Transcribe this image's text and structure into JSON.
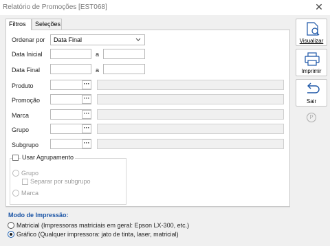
{
  "window": {
    "title": "Relatório de Promoções [EST068]",
    "close_glyph": "✕"
  },
  "tabs": [
    {
      "label": "Filtros",
      "active": true
    },
    {
      "label": "Seleções",
      "active": false
    }
  ],
  "filters": {
    "ordenar_por_label": "Ordenar por",
    "ordenar_por_value": "Data Final",
    "data_inicial_label": "Data Inicial",
    "data_final_label": "Data Final",
    "range_separator": "a",
    "produto_label": "Produto",
    "promocao_label": "Promoção",
    "marca_label": "Marca",
    "grupo_label": "Grupo",
    "subgrupo_label": "Subgrupo",
    "lookup_button": "···"
  },
  "grouping": {
    "usar_agrupamento_label": "Usar Agrupamento",
    "grupo_label": "Grupo",
    "separar_label": "Separar por subgrupo",
    "marca_label": "Marca"
  },
  "print_mode": {
    "title": "Modo de Impressão:",
    "matricial_label": "Matricial (Impressoras matriciais em geral: Epson LX-300, etc.)",
    "grafico_label": "Gráfico (Qualquer impressora: jato de tinta, laser, matricial)",
    "selected": "grafico"
  },
  "actions": {
    "visualizar": "Visualizar",
    "imprimir": "Imprimir",
    "sair": "Sair",
    "help_glyph": "P"
  },
  "colors": {
    "accent": "#1b55a6",
    "panel_bg": "#f0f0f0"
  }
}
